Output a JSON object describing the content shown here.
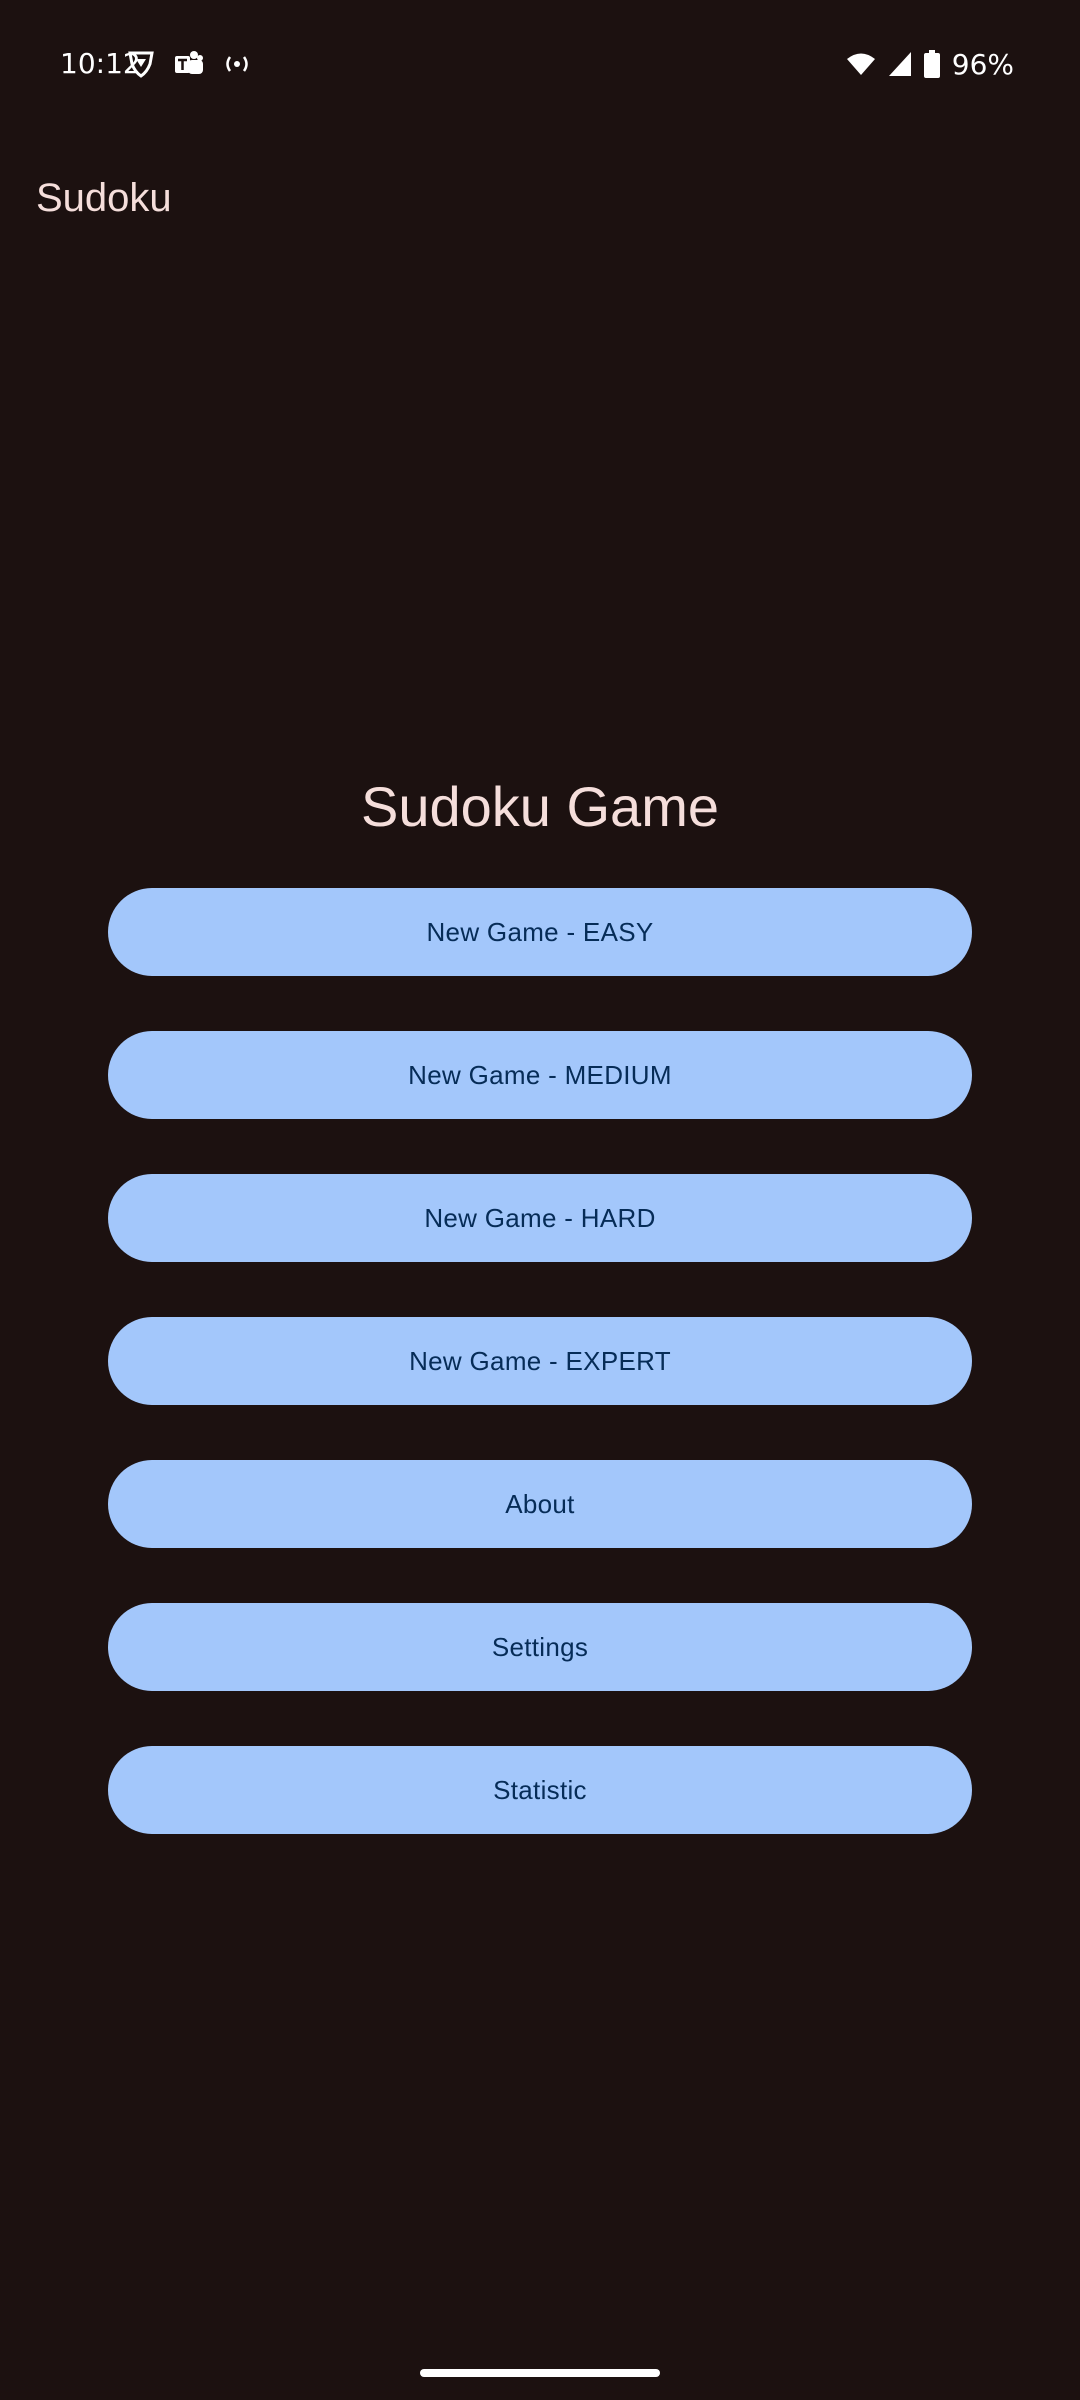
{
  "status_bar": {
    "time": "10:12",
    "battery_text": "96%",
    "icons_left": [
      "vpn-shield-icon",
      "teams-icon",
      "hotspot-icon"
    ],
    "icons_right": [
      "wifi-icon",
      "cell-signal-icon",
      "battery-icon"
    ]
  },
  "app_bar": {
    "title": "Sudoku"
  },
  "main": {
    "title": "Sudoku Game",
    "buttons": [
      {
        "label": "New Game - EASY"
      },
      {
        "label": "New Game - MEDIUM"
      },
      {
        "label": "New Game - HARD"
      },
      {
        "label": "New Game - EXPERT"
      },
      {
        "label": "About"
      },
      {
        "label": "Settings"
      },
      {
        "label": "Statistic"
      }
    ]
  },
  "colors": {
    "background": "#1c1110",
    "button": "#a3c7fb",
    "button_text": "#062c57",
    "title_text": "#f5dedb"
  }
}
